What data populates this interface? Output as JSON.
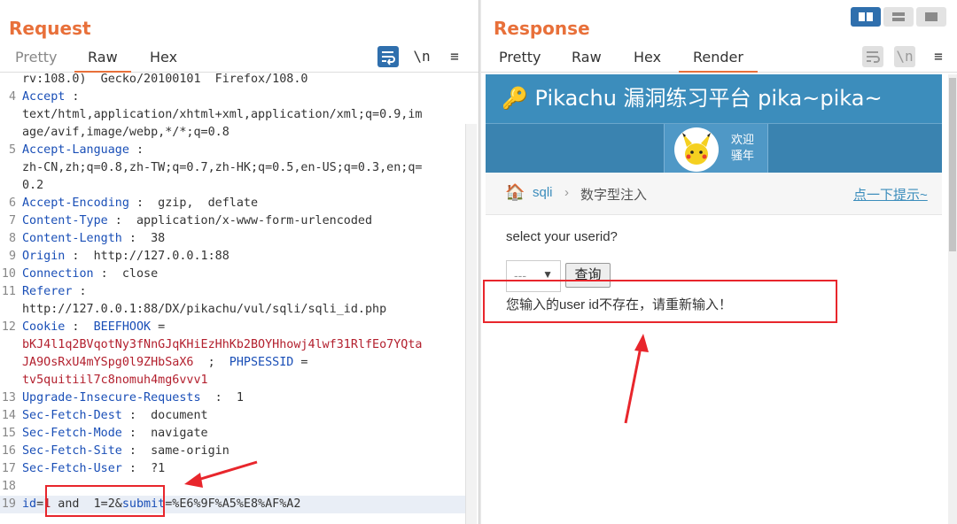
{
  "request": {
    "title": "Request",
    "tabs": [
      "Pretty",
      "Raw",
      "Hex"
    ],
    "tools": {
      "wrap_icon": "wrap-icon",
      "newline_label": "\\n",
      "menu_icon": "≡"
    },
    "lines": [
      {
        "num": "",
        "text": "rv:108.0)  Gecko/20100101  Firefox/108.0"
      },
      {
        "num": "4",
        "key": "Accept",
        "sep": " :"
      },
      {
        "num": "",
        "text": "text/html,application/xhtml+xml,application/xml;q=0.9,im"
      },
      {
        "num": "",
        "text": "age/avif,image/webp,*/*;q=0.8"
      },
      {
        "num": "5",
        "key": "Accept-Language",
        "sep": " :"
      },
      {
        "num": "",
        "text": "zh-CN,zh;q=0.8,zh-TW;q=0.7,zh-HK;q=0.5,en-US;q=0.3,en;q="
      },
      {
        "num": "",
        "text": "0.2"
      },
      {
        "num": "6",
        "key": "Accept-Encoding",
        "sep": " :  gzip,  deflate"
      },
      {
        "num": "7",
        "key": "Content-Type",
        "sep": " :  application/x-www-form-urlencoded"
      },
      {
        "num": "8",
        "key": "Content-Length",
        "sep": " :  38"
      },
      {
        "num": "9",
        "key": "Origin",
        "sep": " :  http://127.0.0.1:88"
      },
      {
        "num": "10",
        "key": "Connection",
        "sep": " :  close"
      },
      {
        "num": "11",
        "key": "Referer",
        "sep": " :"
      },
      {
        "num": "",
        "text": "http://127.0.0.1:88/DX/pikachu/vul/sqli/sqli_id.php"
      },
      {
        "num": "12",
        "key": "Cookie",
        "sep": " :  ",
        "key2": "BEEFHOOK",
        "sep2": " ="
      },
      {
        "num": "",
        "red": "bKJ4l1q2BVqotNy3fNnGJqKHiEzHhKb2BOYHhowj4lwf31RlfEo7YQta"
      },
      {
        "num": "",
        "red": "JA9OsRxU4mYSpg0l9ZHbSaX6",
        "sep": "  ;  ",
        "key": "PHPSESSID",
        "sep2": " ="
      },
      {
        "num": "",
        "red": "tv5quitiil7c8nomuh4mg6vvv1"
      },
      {
        "num": "13",
        "key": "Upgrade-Insecure-Requests",
        "sep": "  :  1"
      },
      {
        "num": "14",
        "key": "Sec-Fetch-Dest",
        "sep": " :  document"
      },
      {
        "num": "15",
        "key": "Sec-Fetch-Mode",
        "sep": " :  navigate"
      },
      {
        "num": "16",
        "key": "Sec-Fetch-Site",
        "sep": " :  same-origin"
      },
      {
        "num": "17",
        "key": "Sec-Fetch-User",
        "sep": " :  ?1"
      },
      {
        "num": "18",
        "text": ""
      },
      {
        "num": "19",
        "key": "id",
        "sep": "=",
        "red": "1",
        "text": " and  1=2&",
        "key2": "submit",
        "sep2": "=%E6%9F%A5%E8%AF%A2",
        "highlight": true
      }
    ]
  },
  "response": {
    "title": "Response",
    "tabs": [
      "Pretty",
      "Raw",
      "Hex",
      "Render"
    ],
    "tools": {
      "wrap_icon": "wrap-icon",
      "newline_label": "\\n",
      "menu_icon": "≡"
    },
    "render": {
      "header": "🔑 Pikachu 漏洞练习平台 pika~pika~",
      "welcome_line1": "欢迎",
      "welcome_line2": "骚年",
      "breadcrumb_home": "🏠",
      "breadcrumb_sqli": "sqli",
      "breadcrumb_sep": "›",
      "breadcrumb_current": "数字型注入",
      "hint_link": "点一下提示~",
      "prompt": "select your userid?",
      "select_value": "---",
      "submit_label": "查询",
      "result_message": "您输入的user id不存在，请重新输入！"
    }
  },
  "colors": {
    "accent": "#e8703a",
    "brand_blue": "#3c8dbc",
    "annotation_red": "#e8262c"
  }
}
